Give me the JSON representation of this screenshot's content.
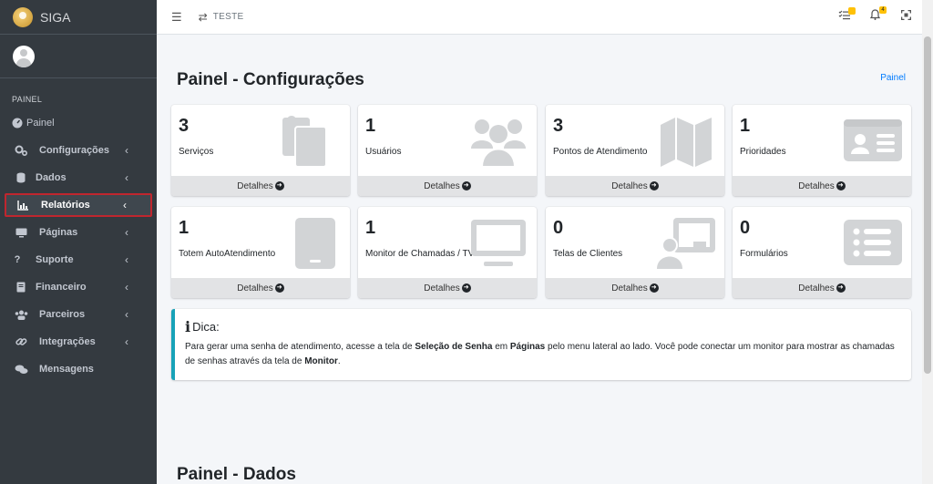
{
  "brand": {
    "name": "SIGA"
  },
  "sidebar": {
    "header": "PAINEL",
    "items": [
      {
        "label": "Painel",
        "icon": "gauge-icon"
      },
      {
        "label": "Configurações",
        "icon": "gears-icon"
      },
      {
        "label": "Dados",
        "icon": "database-icon"
      },
      {
        "label": "Relatórios",
        "icon": "chart-icon",
        "active": true
      },
      {
        "label": "Páginas",
        "icon": "monitor-icon"
      },
      {
        "label": "Suporte",
        "icon": "question-icon"
      },
      {
        "label": "Financeiro",
        "icon": "book-icon"
      },
      {
        "label": "Parceiros",
        "icon": "users-icon"
      },
      {
        "label": "Integrações",
        "icon": "link-icon"
      },
      {
        "label": "Mensagens",
        "icon": "comments-icon"
      }
    ]
  },
  "topbar": {
    "title": "TESTE",
    "badge_tasks": "",
    "badge_notifications": "4"
  },
  "main": {
    "title": "Painel - Configurações",
    "breadcrumb": "Painel",
    "details_label": "Detalhes",
    "cards": [
      {
        "value": "3",
        "label": "Serviços",
        "icon": "copy-icon"
      },
      {
        "value": "1",
        "label": "Usuários",
        "icon": "users-icon"
      },
      {
        "value": "3",
        "label": "Pontos de Atendimento",
        "icon": "map-icon"
      },
      {
        "value": "1",
        "label": "Prioridades",
        "icon": "id-card-icon"
      },
      {
        "value": "1",
        "label": "Totem AutoAtendimento",
        "icon": "tablet-icon"
      },
      {
        "value": "1",
        "label": "Monitor de Chamadas / TVs",
        "icon": "tv-icon"
      },
      {
        "value": "0",
        "label": "Telas de Clientes",
        "icon": "chalkboard-user-icon"
      },
      {
        "value": "0",
        "label": "Formulários",
        "icon": "list-icon"
      }
    ],
    "tip": {
      "title": "Dica:",
      "p1": "Para gerar uma senha de atendimento, acesse a tela de ",
      "b1": "Seleção de Senha",
      "p2": " em ",
      "b2": "Páginas",
      "p3": " pelo menu lateral ao lado. Você pode conectar um monitor para mostrar as chamadas de senhas através da tela de ",
      "b3": "Monitor",
      "p4": "."
    },
    "section2_title": "Painel - Dados"
  },
  "colors": {
    "sidebar": "#343a40",
    "tip_accent": "#17a2b8",
    "link": "#007bff",
    "active_border": "#c0262e",
    "badge": "#ffc107"
  }
}
